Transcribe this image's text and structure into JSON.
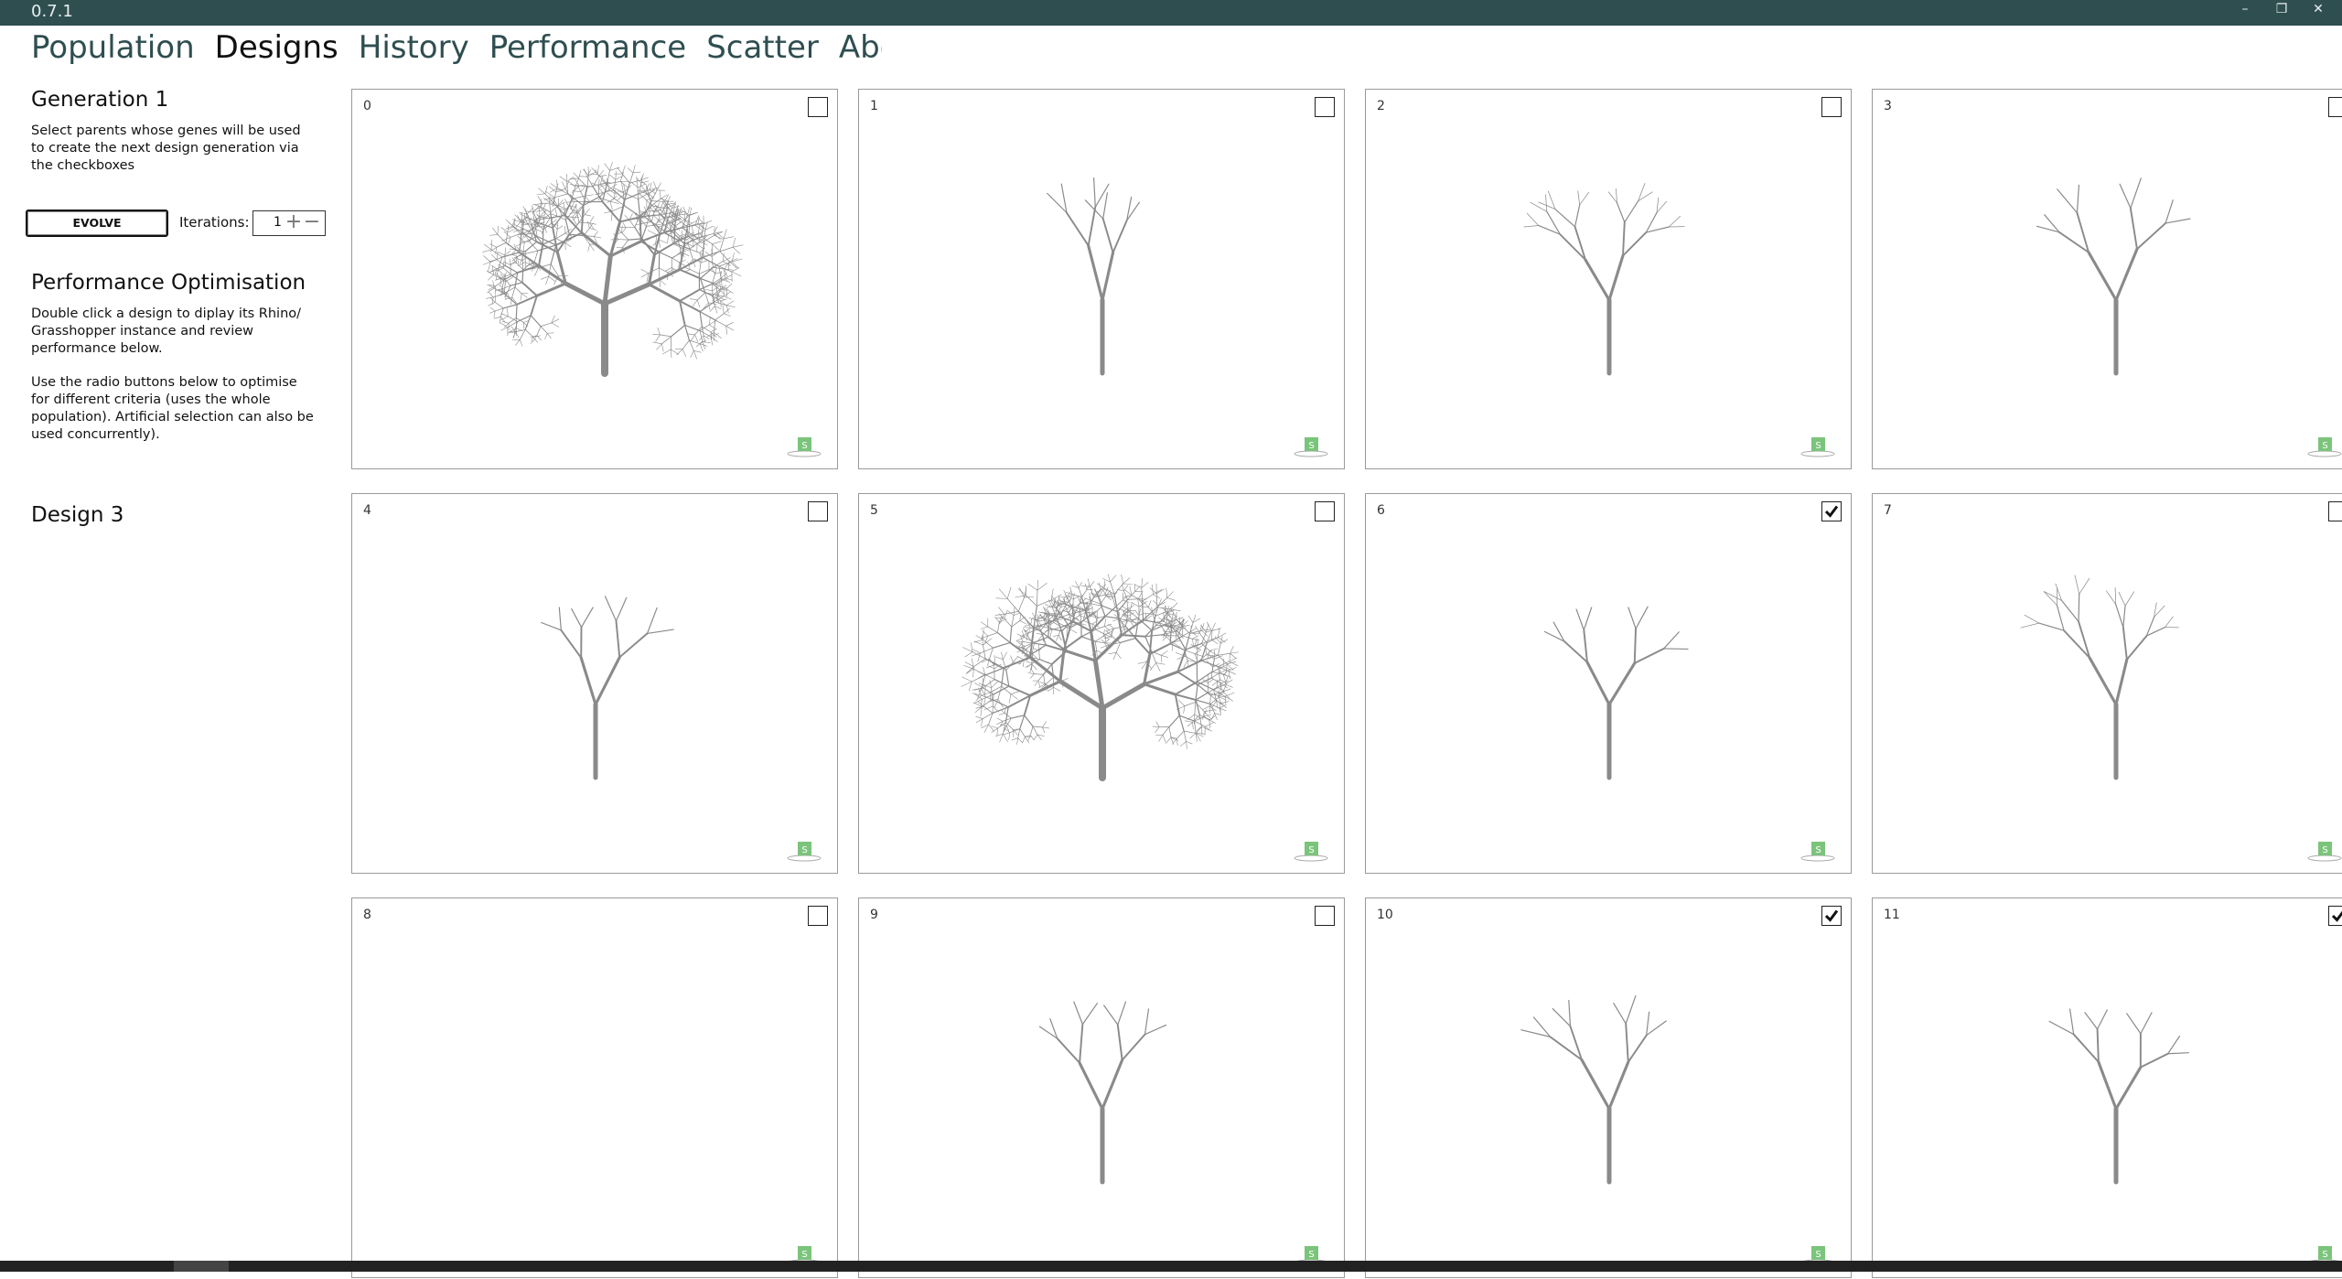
{
  "app": {
    "version": "0.7.1"
  },
  "window_controls": {
    "minimize": "–",
    "restore": "❐",
    "close": "✕"
  },
  "tabs": [
    {
      "label": "Population",
      "active": false
    },
    {
      "label": "Designs",
      "active": true
    },
    {
      "label": "History",
      "active": false
    },
    {
      "label": "Performance",
      "active": false
    },
    {
      "label": "Scatter",
      "active": false
    },
    {
      "label": "About",
      "active": false
    }
  ],
  "sidebar": {
    "generation_title": "Generation 1",
    "generation_text": "Select parents whose genes will be used to create the next design generation via the checkboxes",
    "evolve_label": "EVOLVE",
    "iterations_label": "Iterations:",
    "iterations_value": "1",
    "perf_title": "Performance Optimisation",
    "perf_text_1": "Double click a design to diplay its Rhino/ Grasshopper instance and review performance below.",
    "perf_text_2": "Use the radio buttons below to optimise for different criteria (uses the whole population). Artificial selection can also be used concurrently).",
    "design_title": "Design 3"
  },
  "colors": {
    "titlebar": "#2f4e50",
    "tab_inactive": "#2f4e50",
    "tree": "#8a8a8a",
    "badge": "#7bc47b"
  },
  "designs": [
    {
      "id": "0",
      "checked": false,
      "density": 5,
      "spread": 1.0
    },
    {
      "id": "1",
      "checked": false,
      "density": 2,
      "spread": 0.35
    },
    {
      "id": "2",
      "checked": false,
      "density": 3,
      "spread": 0.45
    },
    {
      "id": "3",
      "checked": false,
      "density": 2,
      "spread": 0.6
    },
    {
      "id": "4",
      "checked": false,
      "density": 2,
      "spread": 0.7
    },
    {
      "id": "5",
      "checked": false,
      "density": 5,
      "spread": 0.9
    },
    {
      "id": "6",
      "checked": true,
      "density": 2,
      "spread": 0.55
    },
    {
      "id": "7",
      "checked": false,
      "density": 3,
      "spread": 0.45
    },
    {
      "id": "8",
      "checked": false,
      "density": 0,
      "spread": 0
    },
    {
      "id": "9",
      "checked": false,
      "density": 2,
      "spread": 0.6
    },
    {
      "id": "10",
      "checked": true,
      "density": 2,
      "spread": 0.35
    },
    {
      "id": "11",
      "checked": true,
      "density": 2,
      "spread": 0.75
    }
  ]
}
